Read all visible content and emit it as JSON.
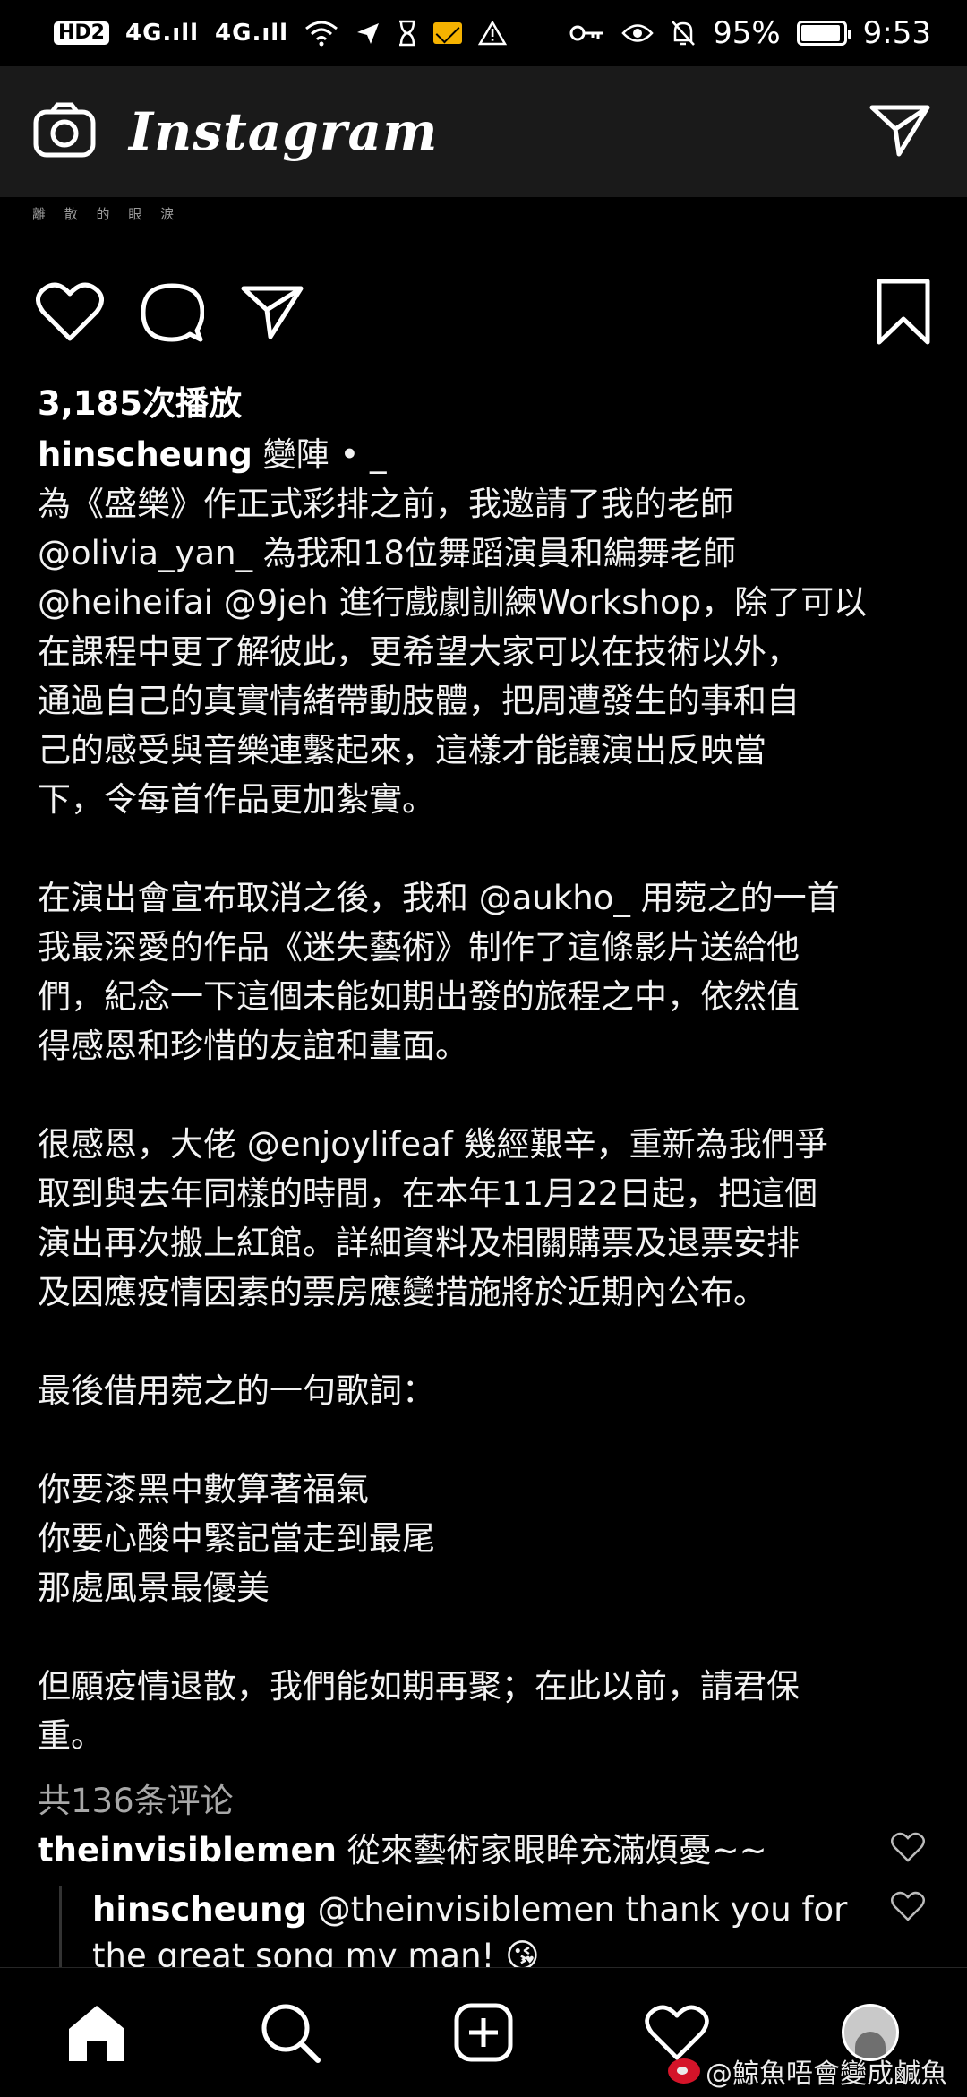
{
  "status_bar": {
    "hd_badge": "HD2",
    "signal_1": "4G.ıll",
    "signal_2": "4G.ıll",
    "battery_text": "95%",
    "battery_level": 0.95,
    "time": "9:53"
  },
  "app_bar": {
    "brand": "Instagram",
    "icons": [
      "camera-icon",
      "direct-message-icon"
    ]
  },
  "video_tail_text": "離 散 的 眼 淚",
  "actions": {
    "icons": [
      "heart-icon",
      "comment-icon",
      "share-icon",
      "bookmark-icon"
    ]
  },
  "post": {
    "views": "3,185次播放",
    "username": "hinscheung",
    "caption_first_line": " 變陣 • _",
    "caption_body": "為《盛樂》作正式彩排之前，我邀請了我的老師\n@olivia_yan_ 為我和18位舞蹈演員和編舞老師\n@heiheifai @9jeh 進行戲劇訓練Workshop，除了可以\n在課程中更了解彼此，更希望大家可以在技術以外，\n通過自己的真實情緒帶動肢體，把周遭發生的事和自\n己的感受與音樂連繫起來，這樣才能讓演出反映當\n下，令每首作品更加紮實。\n\n在演出會宣布取消之後，我和 @aukho_ 用菀之的一首\n我最深愛的作品《迷失藝術》制作了這條影片送給他\n們，紀念一下這個未能如期出發的旅程之中，依然值\n得感恩和珍惜的友誼和畫面。\n\n很感恩，大佬 @enjoylifeaf 幾經艱辛，重新為我們爭\n取到與去年同樣的時間，在本年11月22日起，把這個\n演出再次搬上紅館。詳細資料及相關購票及退票安排\n及因應疫情因素的票房應變措施將於近期內公布。\n\n最後借用菀之的一句歌詞：\n\n你要漆黑中數算著福氣\n你要心酸中緊記當走到最尾\n那處風景最優美\n\n但願疫情退散，我們能如期再聚；在此以前，請君保\n重。"
  },
  "comments": {
    "count_label": "共136条评论",
    "items": [
      {
        "username": "theinvisiblemen",
        "text": " 從來藝術家眼眸充滿煩憂~~"
      }
    ],
    "reply": {
      "username": "hinscheung",
      "text": " @theinvisiblemen thank you for the great song my man! 😘"
    }
  },
  "bottom_nav": {
    "items": [
      "home-icon",
      "search-icon",
      "create-post-icon",
      "activity-heart-icon",
      "profile-avatar"
    ]
  },
  "watermark": "@鯨魚唔會變成鹹魚"
}
